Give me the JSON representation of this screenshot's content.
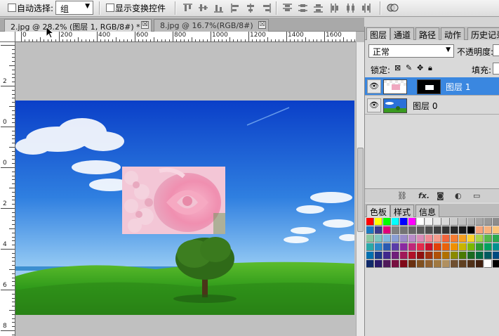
{
  "options_bar": {
    "auto_select_label": "自动选择:",
    "auto_select_value": "组",
    "show_transform_label": "显示变换控件"
  },
  "tabs": [
    {
      "label": "2.jpg @ 28.2% (图层 1, RGB/8#) *",
      "close": "☒"
    },
    {
      "label": "8.jpg @ 16.7%(RGB/8#)",
      "close": "☒"
    }
  ],
  "ruler": {
    "h_labels": [
      "0",
      "200",
      "400",
      "600",
      "800",
      "1000",
      "1200",
      "1400",
      "1600"
    ],
    "v_labels": [
      "2",
      "0",
      "0",
      "2",
      "4",
      "6",
      "8",
      "1"
    ]
  },
  "layers_panel": {
    "tabs": [
      "图层",
      "通道",
      "路径",
      "动作",
      "历史记录"
    ],
    "blend_mode": "正常",
    "opacity_label": "不透明度:",
    "lock_label": "锁定:",
    "fill_label": "填充:",
    "layers": [
      {
        "name": "图层 1",
        "selected": true
      },
      {
        "name": "图层 0",
        "selected": false
      }
    ],
    "footer_icons": [
      "link-icon",
      "fx-icon",
      "mask-icon",
      "adjustment-icon",
      "folder-icon"
    ]
  },
  "swatches_panel": {
    "tabs": [
      "色板",
      "样式",
      "信息"
    ],
    "colors": [
      "#ff0000",
      "#ffff00",
      "#00ff00",
      "#00ffff",
      "#0000ff",
      "#ff00ff",
      "#ffffff",
      "#f2f2f2",
      "#e6e6e6",
      "#d9d9d9",
      "#cccccc",
      "#bfbfbf",
      "#b3b3b3",
      "#a6a6a6",
      "#999999",
      "#8c8c8c",
      "#1a78c2",
      "#3a3a8c",
      "#e0007a",
      "#808080",
      "#737373",
      "#666666",
      "#595959",
      "#4d4d4d",
      "#404040",
      "#333333",
      "#262626",
      "#1a1a1a",
      "#000000",
      "#f5a37a",
      "#f7b27d",
      "#fbc57a",
      "#8cc8a0",
      "#7fc7c0",
      "#80b8e0",
      "#8a9fd4",
      "#9b8cc8",
      "#b98cc8",
      "#d98cb8",
      "#f08c96",
      "#f59c8c",
      "#f2653c",
      "#f57d33",
      "#f7a020",
      "#fcd32c",
      "#a6d44a",
      "#56b84a",
      "#2aa850",
      "#2aa8a8",
      "#2a88c8",
      "#2a5ab0",
      "#5a3ca8",
      "#8a2aa0",
      "#c0267a",
      "#e22a4c",
      "#c8102e",
      "#e0400a",
      "#e8620c",
      "#f09000",
      "#c8b400",
      "#7ab800",
      "#2a9a30",
      "#00a060",
      "#009090",
      "#0070b0",
      "#1a3a8c",
      "#40288c",
      "#70207a",
      "#a01858",
      "#b01028",
      "#901010",
      "#a03010",
      "#b05008",
      "#b07000",
      "#8a8a00",
      "#4a7a00",
      "#1a6a20",
      "#006a40",
      "#005a60",
      "#004a80",
      "#102a6a",
      "#2a1a6a",
      "#501a5a",
      "#781040",
      "#800818",
      "#6a3010",
      "#805020",
      "#906030",
      "#a07840",
      "#b09060",
      "#705030",
      "#604020",
      "#503018",
      "#402010",
      "#ffffff",
      "#000000"
    ]
  }
}
